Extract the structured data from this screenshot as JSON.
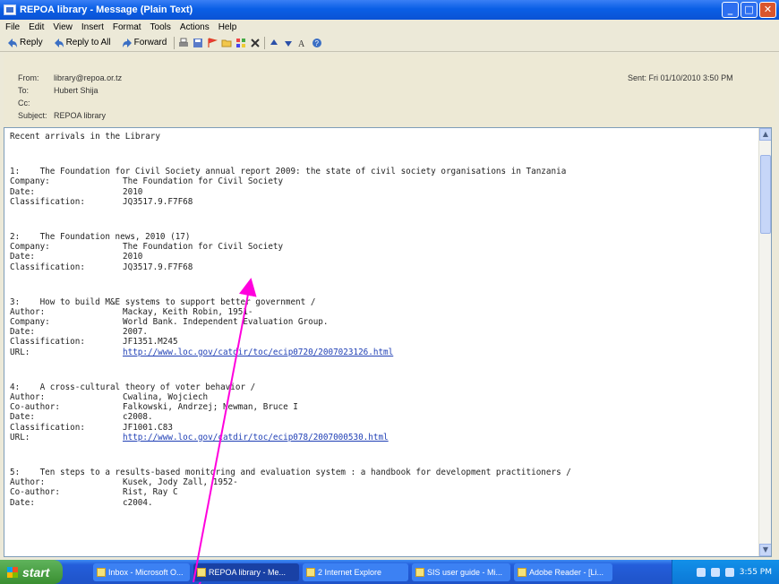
{
  "window": {
    "title": "REPOA library - Message (Plain Text)"
  },
  "menu": [
    "File",
    "Edit",
    "View",
    "Insert",
    "Format",
    "Tools",
    "Actions",
    "Help"
  ],
  "toolbar": {
    "reply": "Reply",
    "reply_all": "Reply to All",
    "forward": "Forward"
  },
  "header": {
    "from_label": "From:",
    "from_value": "library@repoa.or.tz",
    "to_label": "To:",
    "to_value": "Hubert Shija",
    "cc_label": "Cc:",
    "cc_value": "",
    "subject_label": "Subject:",
    "subject_value": "REPOA library",
    "sent": "Sent: Fri 01/10/2010 3:50 PM"
  },
  "body": {
    "intro": "Recent arrivals in the Library",
    "items": [
      {
        "heading": "1:    The Foundation for Civil Society annual report 2009: the state of civil society organisations in Tanzania",
        "fields": [
          {
            "k": "Company:",
            "v": "The Foundation for Civil Society"
          },
          {
            "k": "Date:",
            "v": "2010"
          },
          {
            "k": "Classification:",
            "v": "JQ3517.9.F7F68"
          }
        ]
      },
      {
        "heading": "2:    The Foundation news, 2010 (17)",
        "fields": [
          {
            "k": "Company:",
            "v": "The Foundation for Civil Society"
          },
          {
            "k": "Date:",
            "v": "2010"
          },
          {
            "k": "Classification:",
            "v": "JQ3517.9.F7F68"
          }
        ]
      },
      {
        "heading": "3:    How to build M&E systems to support better government /",
        "fields": [
          {
            "k": "Author:",
            "v": "Mackay, Keith Robin, 1951-"
          },
          {
            "k": "Company:",
            "v": "World Bank. Independent Evaluation Group."
          },
          {
            "k": "Date:",
            "v": "2007."
          },
          {
            "k": "Classification:",
            "v": "JF1351.M245"
          },
          {
            "k": "URL:",
            "v": "http://www.loc.gov/catdir/toc/ecip0720/2007023126.html",
            "link": true
          }
        ]
      },
      {
        "heading": "4:    A cross-cultural theory of voter behavior /",
        "fields": [
          {
            "k": "Author:",
            "v": "Cwalina, Wojciech"
          },
          {
            "k": "Co-author:",
            "v": "Falkowski, Andrzej; Newman, Bruce I"
          },
          {
            "k": "Date:",
            "v": "c2008."
          },
          {
            "k": "Classification:",
            "v": "JF1001.C83"
          },
          {
            "k": "URL:",
            "v": "http://www.loc.gov/catdir/toc/ecip078/2007000530.html",
            "link": true
          }
        ]
      },
      {
        "heading": "5:    Ten steps to a results-based monitoring and evaluation system : a handbook for development practitioners /",
        "fields": [
          {
            "k": "Author:",
            "v": "Kusek, Jody Zall, 1952-"
          },
          {
            "k": "Co-author:",
            "v": "Rist, Ray C"
          },
          {
            "k": "Date:",
            "v": "c2004."
          }
        ]
      }
    ]
  },
  "taskbar": {
    "start": "start",
    "tasks": [
      {
        "label": "Inbox - Microsoft O...",
        "active": false
      },
      {
        "label": "REPOA library - Me...",
        "active": true
      },
      {
        "label": "2 Internet Explore",
        "active": false
      },
      {
        "label": "SIS user guide - Mi...",
        "active": false
      },
      {
        "label": "Adobe Reader - [Li...",
        "active": false
      }
    ],
    "clock": "3:55 PM"
  },
  "colors": {
    "annotation_arrow": "#ff00dd",
    "link": "#1f3fb5",
    "titlebar": "#0a5fe6"
  }
}
